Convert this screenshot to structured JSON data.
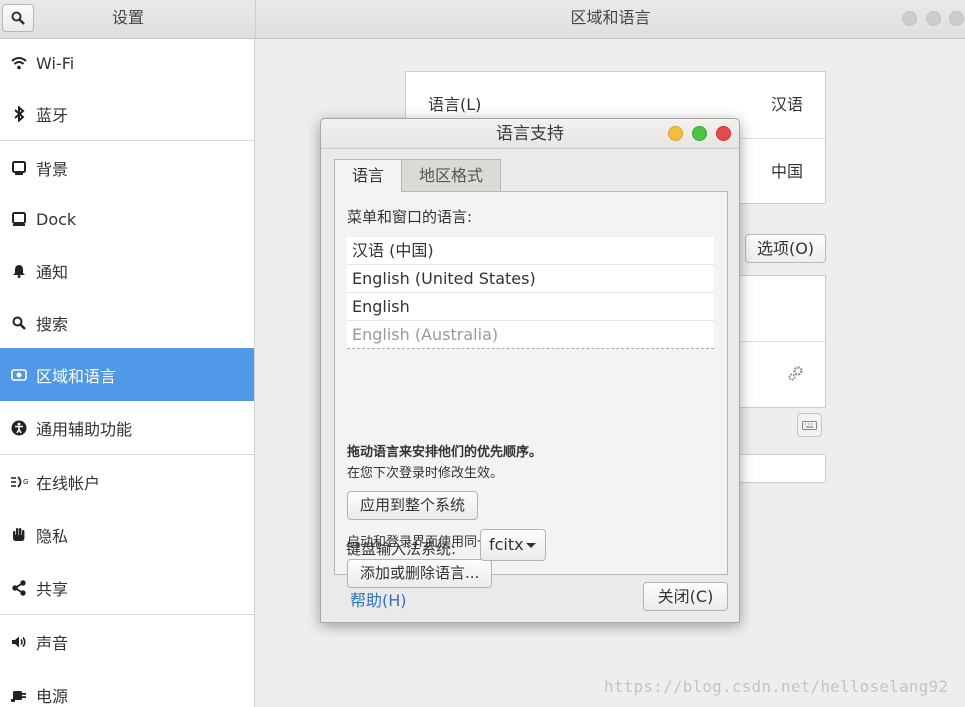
{
  "header": {
    "left_title": "设置",
    "right_title": "区域和语言"
  },
  "sidebar": {
    "items": [
      {
        "label": "Wi-Fi",
        "icon": "wifi-icon"
      },
      {
        "label": "蓝牙",
        "icon": "bluetooth-icon"
      },
      {
        "label": "背景",
        "icon": "background-icon"
      },
      {
        "label": "Dock",
        "icon": "dock-icon"
      },
      {
        "label": "通知",
        "icon": "bell-icon"
      },
      {
        "label": "搜索",
        "icon": "search-icon"
      },
      {
        "label": "区域和语言",
        "icon": "region-icon",
        "active": true
      },
      {
        "label": "通用辅助功能",
        "icon": "accessibility-icon"
      },
      {
        "label": "在线帐户",
        "icon": "online-accounts-icon"
      },
      {
        "label": "隐私",
        "icon": "hand-icon"
      },
      {
        "label": "共享",
        "icon": "share-icon"
      },
      {
        "label": "声音",
        "icon": "speaker-icon"
      },
      {
        "label": "电源",
        "icon": "power-icon"
      }
    ]
  },
  "main": {
    "language_label": "语言(L)",
    "language_value": "汉语",
    "formats_value": "中国",
    "options_button": "选项(O)"
  },
  "dialog": {
    "title": "语言支持",
    "tabs": [
      "语言",
      "地区格式"
    ],
    "menu_language_heading": "菜单和窗口的语言:",
    "languages": [
      "汉语 (中国)",
      "English (United States)",
      "English",
      "English (Australia)"
    ],
    "drag_hint": "拖动语言来安排他们的优先顺序。",
    "effect_hint": "在您下次登录时修改生效。",
    "apply_button": "应用到整个系统",
    "login_hint": "启动和登录界面使用同一语言。",
    "add_remove_button": "添加或删除语言...",
    "keyboard_label": "键盘输入法系统:",
    "keyboard_value": "fcitx",
    "help_link": "帮助(H)",
    "close_button": "关闭(C)"
  },
  "watermark": "https://blog.csdn.net/helloselang92",
  "colors": {
    "accent": "#4f99e8",
    "close_light": "#e8494a",
    "minimize_light": "#f5bd3b",
    "maximize_light": "#4bc542",
    "link": "#2b74c8"
  }
}
